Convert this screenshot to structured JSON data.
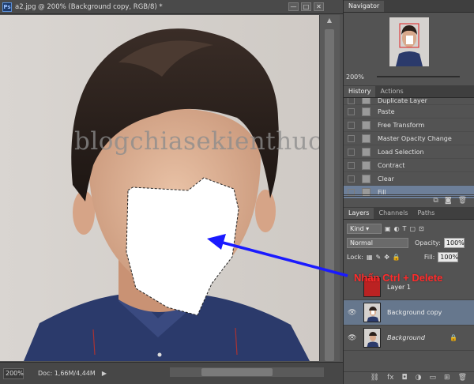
{
  "document": {
    "app_badge": "Ps",
    "title": "a2.jpg @ 200% (Background copy, RGB/8) *",
    "window_buttons": [
      "—",
      "□",
      "✕"
    ],
    "zoom": "200%",
    "doc_info": "Doc: 1,66M/4,44M"
  },
  "overlay": {
    "watermark": "blogchiasekienthuc.com",
    "callout": "Nhấn Ctrl + Delete",
    "arrow_color": "#1a1aff",
    "callout_color": "#ff2b2b"
  },
  "navigator": {
    "tab": "Navigator",
    "zoom": "200%"
  },
  "history": {
    "tabs": [
      "History",
      "Actions"
    ],
    "items": [
      {
        "label": "Duplicate Layer",
        "selected": false
      },
      {
        "label": "Paste",
        "selected": false
      },
      {
        "label": "Free Transform",
        "selected": false
      },
      {
        "label": "Master Opacity Change",
        "selected": false
      },
      {
        "label": "Load Selection",
        "selected": false
      },
      {
        "label": "Contract",
        "selected": false
      },
      {
        "label": "Clear",
        "selected": false
      },
      {
        "label": "Fill",
        "selected": true
      }
    ]
  },
  "layers": {
    "tabs": [
      "Layers",
      "Channels",
      "Paths"
    ],
    "filter_kind": "Kind",
    "blend_mode": "Normal",
    "opacity_label": "Opacity:",
    "opacity": "100%",
    "lock_label": "Lock:",
    "fill_label": "Fill:",
    "fill": "100%",
    "items": [
      {
        "name": "Layer 1",
        "selected": false,
        "visible": false,
        "italic": false
      },
      {
        "name": "Background copy",
        "selected": true,
        "visible": true,
        "italic": false
      },
      {
        "name": "Background",
        "selected": false,
        "visible": true,
        "italic": true
      }
    ]
  },
  "colors": {
    "selection_blue": "#6d7f99",
    "panel_bg": "#535353",
    "shirt_navy": "#2b3a6b"
  }
}
